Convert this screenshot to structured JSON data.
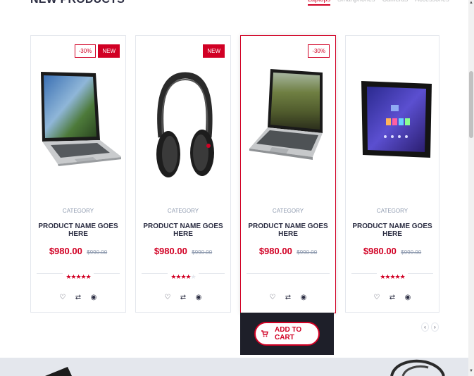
{
  "section": {
    "title": "New Products",
    "tabs": [
      {
        "label": "Laptops",
        "active": true
      },
      {
        "label": "Smartphones",
        "active": false
      },
      {
        "label": "Cameras",
        "active": false
      },
      {
        "label": "Accessories",
        "active": false
      }
    ]
  },
  "products": [
    {
      "labels": [
        {
          "text": "-30%",
          "kind": "sale"
        },
        {
          "text": "NEW",
          "kind": "new"
        }
      ],
      "image": "laptop-icon",
      "category": "Category",
      "name": "product name goes here",
      "price": "$980.00",
      "old_price": "$990.00",
      "rating": 5
    },
    {
      "labels": [
        {
          "text": "NEW",
          "kind": "new"
        }
      ],
      "image": "headphones-icon",
      "category": "Category",
      "name": "product name goes here",
      "price": "$980.00",
      "old_price": "$990.00",
      "rating": 4
    },
    {
      "labels": [
        {
          "text": "-30%",
          "kind": "sale"
        }
      ],
      "image": "laptop-icon",
      "category": "Category",
      "name": "product name goes here",
      "price": "$980.00",
      "old_price": "$990.00",
      "rating": 0
    },
    {
      "labels": [],
      "image": "tablet-icon",
      "category": "Category",
      "name": "product name goes here",
      "price": "$980.00",
      "old_price": "$990.00",
      "rating": 5
    }
  ],
  "actions": {
    "wishlist": "heart-icon",
    "compare": "exchange-icon",
    "quickview": "eye-icon"
  },
  "cart": {
    "label": "add to cart",
    "icon": "shopping-cart-icon"
  },
  "nav": {
    "prev": "‹",
    "next": "›"
  },
  "colors": {
    "accent": "#d10024",
    "dark": "#1e1f29",
    "text": "#2b2d42",
    "muted": "#8d99ae",
    "border": "#e4e7ed"
  }
}
